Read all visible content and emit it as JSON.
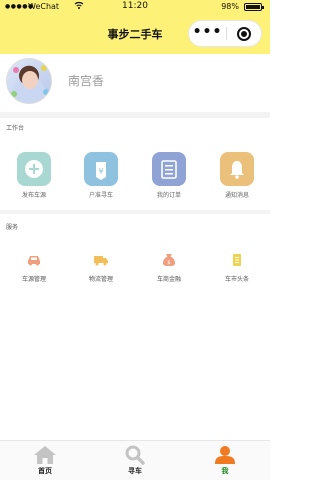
{
  "status_bar": {
    "signal": "●●●●●",
    "carrier": "WeChat",
    "time": "11:20",
    "battery": "98%"
  },
  "nav": {
    "title": "事步二手车",
    "more_label": "•••"
  },
  "profile": {
    "username": "南宫香"
  },
  "workbench": {
    "title": "工作台",
    "items": [
      {
        "label": "发布车源",
        "icon": "plus-circle-icon",
        "color": "#a9d8d3"
      },
      {
        "label": "户准寻车",
        "icon": "price-tag-icon",
        "color": "#8ec2de"
      },
      {
        "label": "我的订单",
        "icon": "clipboard-icon",
        "color": "#8fa3d4"
      },
      {
        "label": "通知消息",
        "icon": "bell-icon",
        "color": "#ebc07a"
      }
    ]
  },
  "services": {
    "title": "服务",
    "items": [
      {
        "label": "车源管理",
        "icon": "car-icon",
        "color": "#ef9e7e"
      },
      {
        "label": "物流管理",
        "icon": "truck-icon",
        "color": "#f2bf5a"
      },
      {
        "label": "车商金融",
        "icon": "money-bag-icon",
        "color": "#ef9e7e"
      },
      {
        "label": "车市头条",
        "icon": "document-icon",
        "color": "#eed44c"
      }
    ]
  },
  "tabs": [
    {
      "label": "首页",
      "icon": "home-icon",
      "active": false
    },
    {
      "label": "寻车",
      "icon": "search-icon",
      "active": false
    },
    {
      "label": "我",
      "icon": "user-icon",
      "active": true
    }
  ],
  "colors": {
    "header": "#fdf277",
    "active_tab": "#f07b22",
    "inactive_tab": "#c4c4c4"
  }
}
